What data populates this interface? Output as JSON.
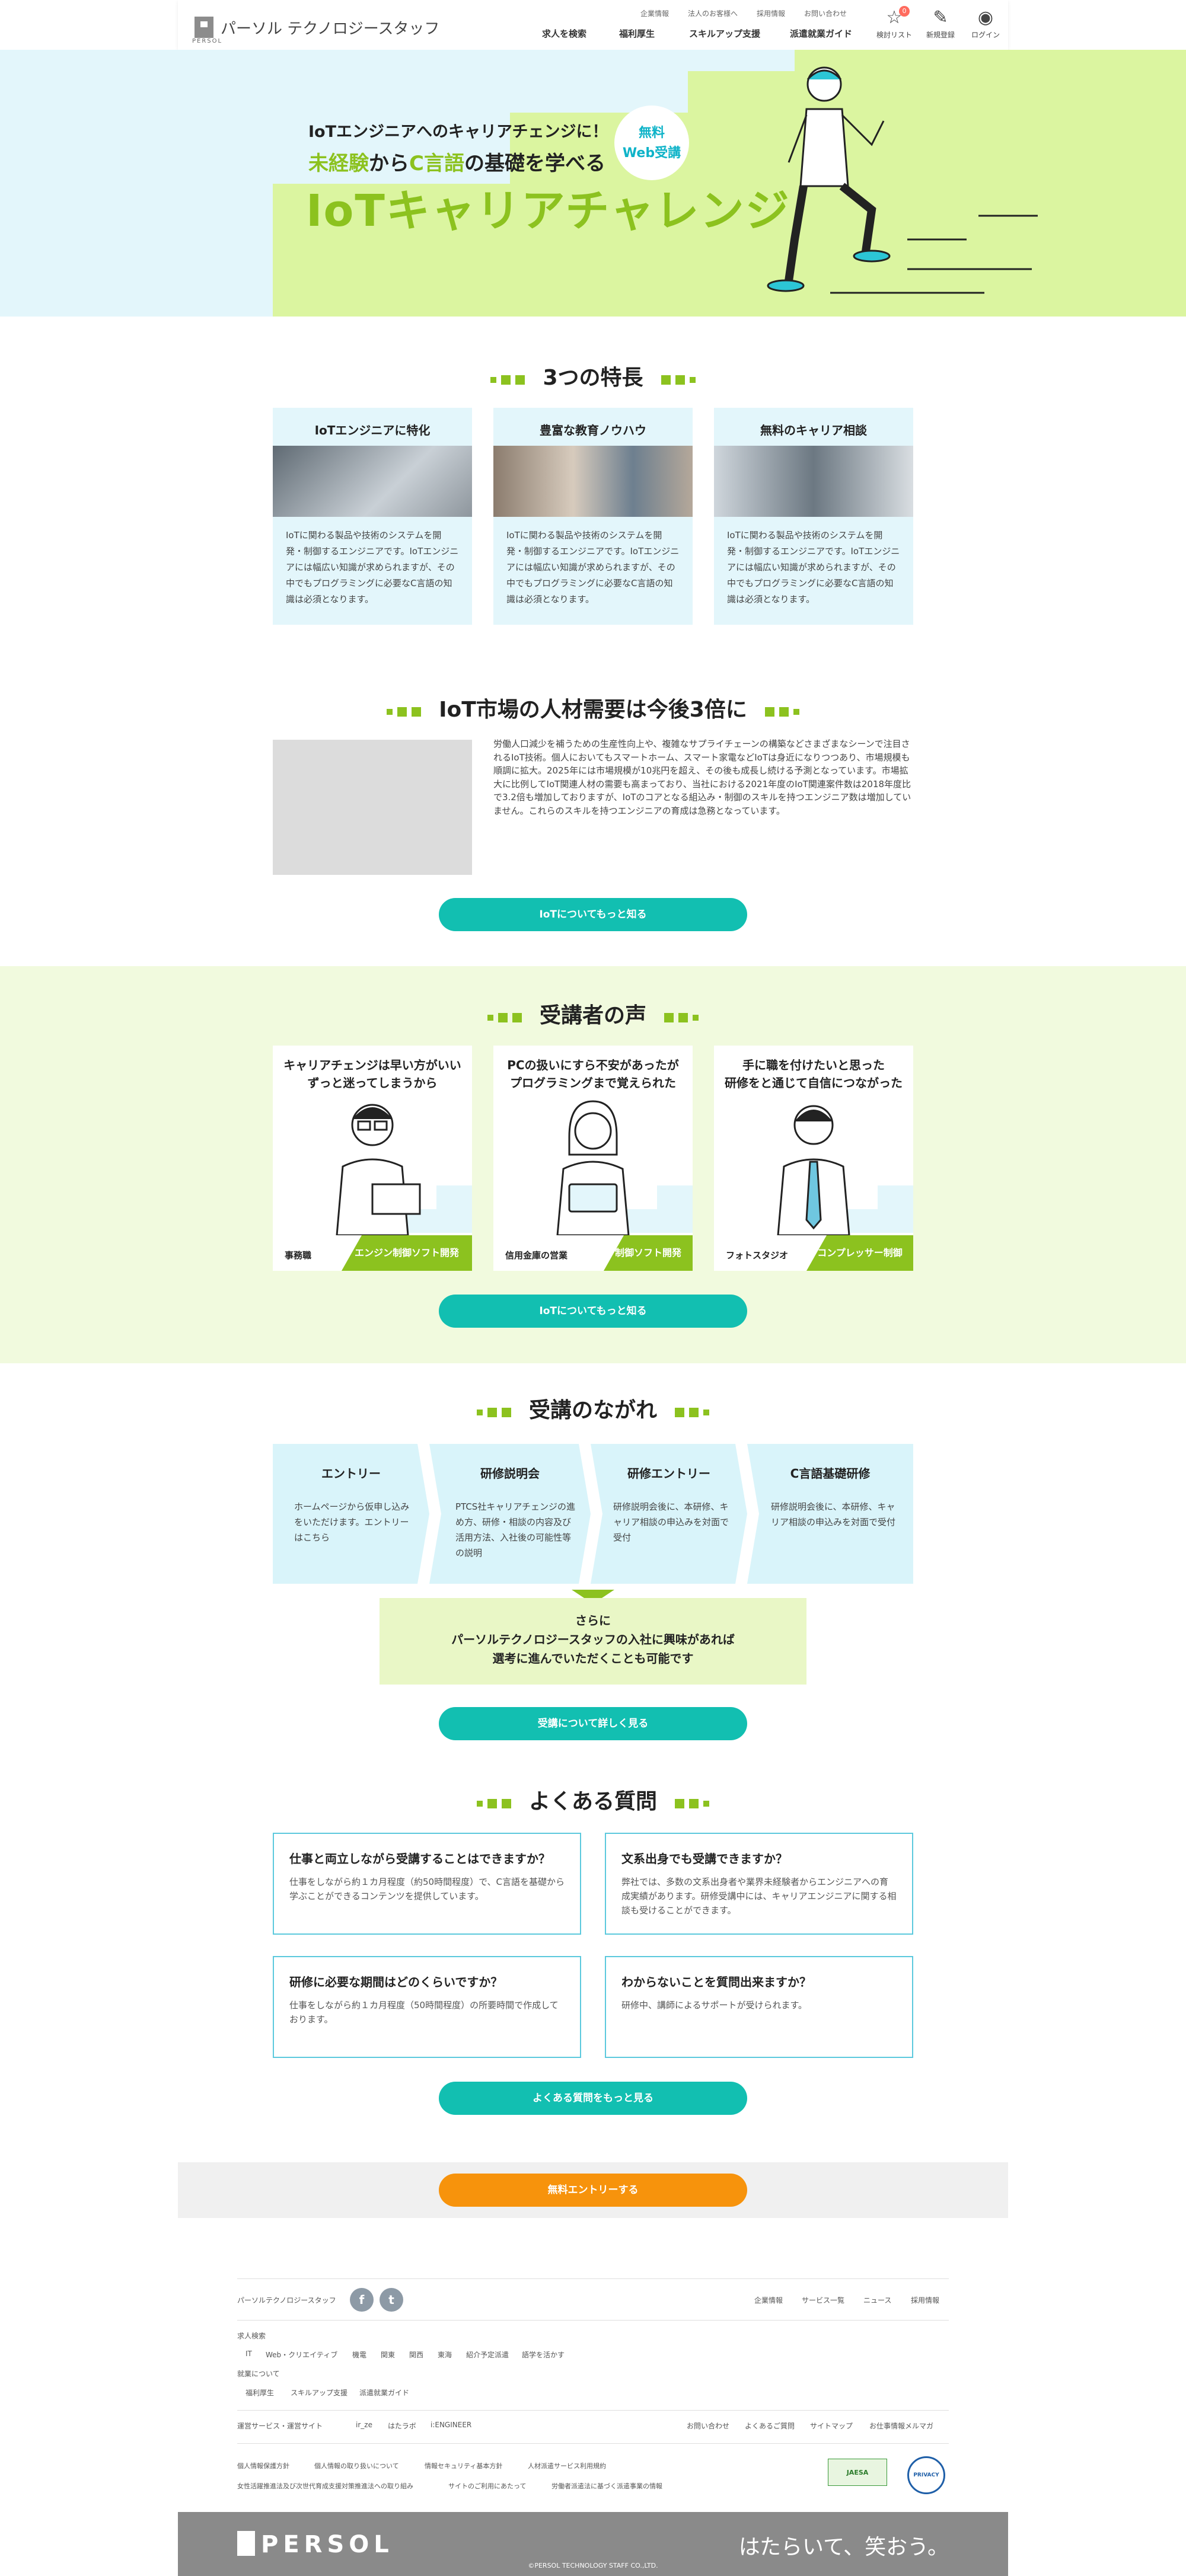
{
  "header": {
    "logo_text": "パーソル テクノロジースタッフ",
    "logo_small": "PERSOL",
    "util_links": [
      "企業情報",
      "法人のお客様へ",
      "採用情報",
      "お問い合わせ"
    ],
    "nav": [
      "求人を検索",
      "福利厚生",
      "スキルアップ支援",
      "派遣就業ガイド"
    ],
    "icons": {
      "favorites": {
        "label": "検討リスト",
        "icon": "star-icon",
        "badge": "0"
      },
      "register": {
        "label": "新規登録",
        "icon": "edit-icon"
      },
      "login": {
        "label": "ログイン",
        "icon": "user-icon"
      }
    }
  },
  "hero": {
    "line1": "IoTエンジニアへのキャリアチェンジに！",
    "line2_a": "未経験",
    "line2_b": "から",
    "line2_c": "C言語",
    "line2_d": "の基礎を学べる",
    "line3": "IoTキャリアチャレンジ",
    "badge_line1": "無料",
    "badge_line2": "Web受講"
  },
  "features": {
    "title": "3つの特長",
    "items": [
      {
        "title": "IoTエンジニアに特化",
        "text": "IoTに関わる製品や技術のシステムを開発・制御するエンジニアです。IoTエンジニアには幅広い知識が求められますが、その中でもプログラミングに必要なC言語の知識は必須となります。"
      },
      {
        "title": "豊富な教育ノウハウ",
        "text": "IoTに関わる製品や技術のシステムを開発・制御するエンジニアです。IoTエンジニアには幅広い知識が求められますが、その中でもプログラミングに必要なC言語の知識は必須となります。"
      },
      {
        "title": "無料のキャリア相談",
        "text": "IoTに関わる製品や技術のシステムを開発・制御するエンジニアです。IoTエンジニアには幅広い知識が求められますが、その中でもプログラミングに必要なC言語の知識は必須となります。"
      }
    ]
  },
  "market": {
    "title": "IoT市場の人材需要は今後3倍に",
    "text": "労働人口減少を補うための生産性向上や、複雑なサプライチェーンの構築などさまざまなシーンで注目されるIoT技術。個人においてもスマートホーム、スマート家電などIoTは身近になりつつあり、市場規模も順調に拡大。2025年には市場規模が10兆円を超え、その後も成長し続ける予測となっています。市場拡大に比例してIoT関連人材の需要も高まっており、当社における2021年度のIoT関連案件数は2018年度比で3.2倍も増加しておりますが、IoTのコアとなる組込み・制御のスキルを持つエンジニア数は増加していません。これらのスキルを持つエンジニアの育成は急務となっています。",
    "button": "IoTについてもっと知る"
  },
  "voices": {
    "title": "受講者の声",
    "items": [
      {
        "title_a": "キャリアチェンジは早い方がいい",
        "title_b": "ずっと迷ってしまうから",
        "who": "事務職",
        "tag": "エンジン制御ソフト開発"
      },
      {
        "title_a": "PCの扱いにすら不安があったが",
        "title_b": "プログラミングまで覚えられた",
        "who": "信用金庫の営業",
        "tag": "制御ソフト開発"
      },
      {
        "title_a": "手に職を付けたいと思った",
        "title_b": "研修をと通じて自信につながった",
        "who": "フォトスタジオ",
        "tag": "コンプレッサー制御"
      }
    ],
    "button": "IoTについてもっと知る"
  },
  "flow": {
    "title": "受講のながれ",
    "steps": [
      {
        "title": "エントリー",
        "text": "ホームページから仮申し込みをいただけます。エントリーはこちら"
      },
      {
        "title": "研修説明会",
        "text": "PTCS社キャリアチェンジの進め方、研修・相談の内容及び活用方法、入社後の可能性等の説明"
      },
      {
        "title": "研修エントリー",
        "text": "研修説明会後に、本研修、キャリア相談の申込みを対面で受付"
      },
      {
        "title": "C言語基礎研修",
        "text": "研修説明会後に、本研修、キャリア相談の申込みを対面で受付"
      }
    ],
    "more_a": "さらに",
    "more_b": "パーソルテクノロジースタッフの入社に興味があれば",
    "more_c": "選考に進んでいただくことも可能です",
    "button": "受講について詳しく見る"
  },
  "faq": {
    "title": "よくある質問",
    "items": [
      {
        "q": "仕事と両立しながら受講することはできますか？",
        "a": "仕事をしながら約１カ月程度（約50時間程度）で、C言語を基礎から学ぶことができるコンテンツを提供しています。"
      },
      {
        "q": "文系出身でも受講できますか？",
        "a": "弊社では、多数の文系出身者や業界未経験者からエンジニアへの育成実績があります。研修受講中には、キャリアエンジニアに関する相談も受けることができます。"
      },
      {
        "q": "研修に必要な期間はどのくらいですか？",
        "a": "仕事をしながら約１カ月程度（50時間程度）の所要時間で作成しております。"
      },
      {
        "q": "わからないことを質問出来ますか？",
        "a": "研修中、講師によるサポートが受けられます。"
      }
    ],
    "button": "よくある質問をもっと見る"
  },
  "cta": {
    "button": "無料エントリーする"
  },
  "footer": {
    "brand": "パーソルテクノロジースタッフ",
    "sns": [
      {
        "icon": "facebook-icon",
        "glyph": "f"
      },
      {
        "icon": "twitter-icon",
        "glyph": "t"
      }
    ],
    "top_links": [
      "企業情報",
      "サービス一覧",
      "ニュース",
      "採用情報"
    ],
    "search_heading": "求人検索",
    "search_links": [
      "IT",
      "Web・クリエイティブ",
      "機電",
      "関東",
      "関西",
      "東海",
      "紹介予定派遣",
      "語学を活かす"
    ],
    "work_heading": "就業について",
    "work_links": [
      "福利厚生",
      "スキルアップ支援",
      "派遣就業ガイド"
    ],
    "related_heading": "運営サービス・運営サイト",
    "related_links": [
      "ir_ze",
      "はたラボ",
      "i:ENGINEER"
    ],
    "right_links": [
      "お問い合わせ",
      "よくあるご質問",
      "サイトマップ",
      "お仕事情報メルマガ"
    ],
    "legal_row1": [
      "個人情報保護方針",
      "個人情報の取り扱いについて",
      "情報セキュリティ基本方針",
      "人材派遣サービス利用規約"
    ],
    "legal_row2": [
      "女性活躍推進法及び次世代育成支援対策推進法への取り組み",
      "サイトのご利用にあたって",
      "労働者派遣法に基づく派遣事業の情報"
    ],
    "cert1": "JAESA",
    "cert2": "PRIVACY",
    "logo": "PERSOL",
    "copyright": "©PERSOL TECHNOLOGY STAFF CO.,LTD.",
    "slogan": "はたらいて、笑おう。"
  },
  "colors": {
    "accent_green": "#8cc21f",
    "accent_teal": "#12bfb1",
    "light_blue": "#e3f6fb",
    "cta_orange": "#f7930c"
  }
}
